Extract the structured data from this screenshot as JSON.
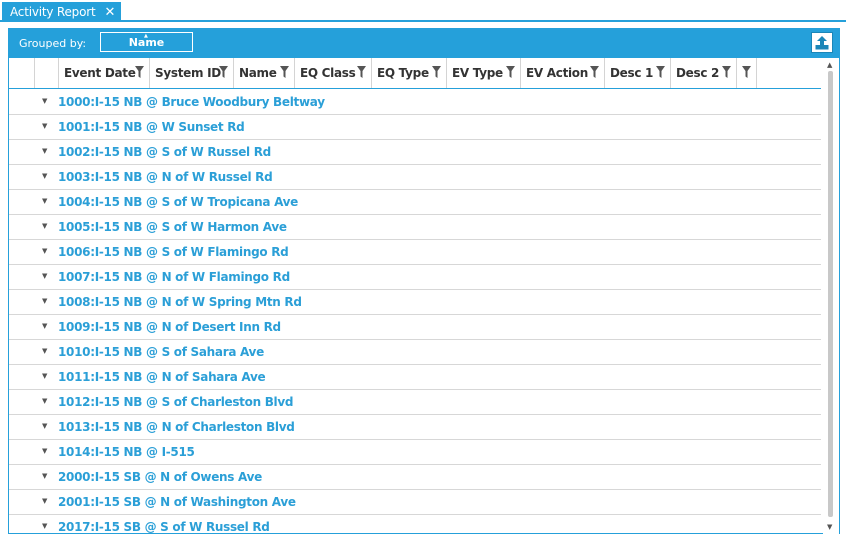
{
  "tab": {
    "title": "Activity Report",
    "close_glyph": "✕"
  },
  "group_panel": {
    "label": "Grouped by:",
    "chip_label": "Name",
    "chip_sort_glyph": "▲"
  },
  "export_icon": "upload-export-icon",
  "columns": [
    {
      "label": "Event Date"
    },
    {
      "label": "System ID"
    },
    {
      "label": "Name"
    },
    {
      "label": "EQ Class"
    },
    {
      "label": "EQ Type"
    },
    {
      "label": "EV Type"
    },
    {
      "label": "EV Action"
    },
    {
      "label": "Desc 1"
    },
    {
      "label": "Desc 2"
    },
    {
      "label": ""
    }
  ],
  "expander_glyph": "▼",
  "groups": [
    {
      "label": "1000:I-15 NB @ Bruce Woodbury Beltway"
    },
    {
      "label": "1001:I-15 NB @ W Sunset Rd"
    },
    {
      "label": "1002:I-15 NB @ S of W Russel Rd"
    },
    {
      "label": "1003:I-15 NB @ N of W Russel Rd"
    },
    {
      "label": "1004:I-15 NB @ S of W Tropicana Ave"
    },
    {
      "label": "1005:I-15 NB @ S of W Harmon Ave"
    },
    {
      "label": "1006:I-15 NB @ S of W Flamingo Rd"
    },
    {
      "label": "1007:I-15 NB @ N of W Flamingo Rd"
    },
    {
      "label": "1008:I-15 NB @ N of W Spring Mtn Rd"
    },
    {
      "label": "1009:I-15 NB @ N of Desert Inn Rd"
    },
    {
      "label": "1010:I-15 NB @ S of Sahara Ave"
    },
    {
      "label": "1011:I-15 NB @ N of Sahara Ave"
    },
    {
      "label": "1012:I-15 NB @ S of Charleston Blvd"
    },
    {
      "label": "1013:I-15 NB @ N of Charleston Blvd"
    },
    {
      "label": "1014:I-15 NB @ I-515"
    },
    {
      "label": "2000:I-15 SB @ N of Owens Ave"
    },
    {
      "label": "2001:I-15 SB @ N of Washington Ave"
    },
    {
      "label": "2017:I-15 SB @ S of W Russel Rd"
    }
  ],
  "scrollbar": {
    "up_glyph": "▲",
    "down_glyph": "▼"
  },
  "colors": {
    "accent": "#25a0da",
    "link": "#2b9fd7",
    "divider": "#d7d7d7"
  }
}
